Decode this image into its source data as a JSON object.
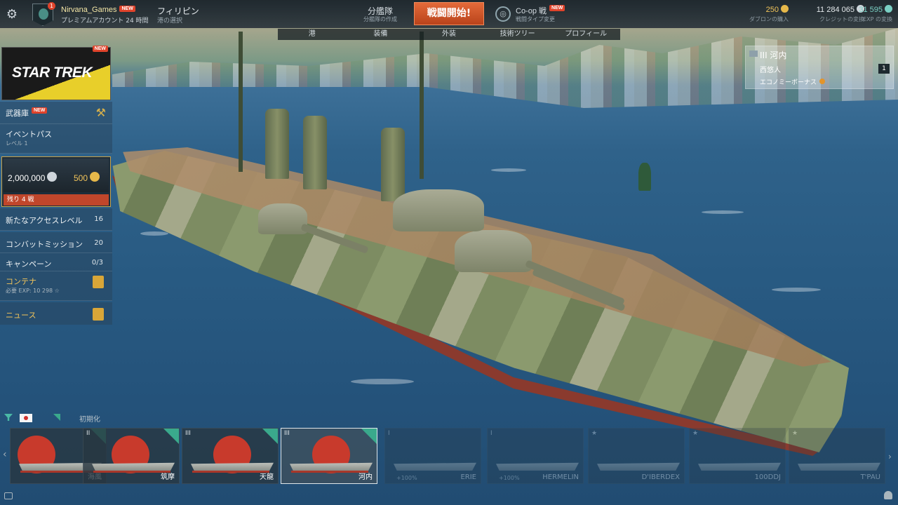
{
  "topbar": {
    "settings_icon": "gear-icon",
    "player": {
      "name": "Nirvana_Games",
      "new_badge": "NEW",
      "premium": "プレミアムアカウント 24 時間",
      "emblem_badge": "1"
    },
    "region": {
      "name": "フィリピン",
      "sub": "港の選択"
    },
    "division": {
      "label": "分艦隊",
      "sub": "分艦隊の作成"
    },
    "battle_button": "戦闘開始!",
    "mode": {
      "label": "Co-op 戦",
      "new_badge": "NEW",
      "sub": "戦闘タイプ変更"
    },
    "currencies": [
      {
        "value": "250",
        "sub": "ダブロンの購入",
        "color": "#e6b84a"
      },
      {
        "value": "11 284 065",
        "sub": "クレジットの変換",
        "color": "#cfd6dc"
      },
      {
        "value": "31 595",
        "sub": "EXP の変換",
        "color": "#7ad0c4"
      }
    ]
  },
  "subnav": {
    "tabs": [
      "港",
      "装備",
      "外装",
      "技術ツリー",
      "プロフィール"
    ]
  },
  "left_panel": {
    "star_trek": {
      "logo": "STAR TREK",
      "new_badge": "NEW"
    },
    "armory": {
      "label": "武器庫",
      "new_badge": "NEW"
    },
    "event_pass": {
      "label": "イベントパス",
      "level": "レベル 1"
    },
    "wallet": {
      "credits": "2,000,000",
      "gold": "500",
      "remaining": "残り 4 戦"
    },
    "access_level": {
      "label": "新たなアクセスレベル",
      "value": "16"
    },
    "combat_missions": {
      "label": "コンバットミッション",
      "value": "20"
    },
    "campaign": {
      "label": "キャンペーン",
      "value": "0/3"
    },
    "containers": {
      "label": "コンテナ",
      "sub": "必要 EXP: 10 298 ☆"
    },
    "news": {
      "label": "ニュース"
    }
  },
  "ship_panel": {
    "tier_name": "III 河内",
    "commander": "西悠人",
    "commander_count": "1",
    "economy": "エコノミーボーナス"
  },
  "carousel": {
    "reset": "初期化",
    "cards": [
      {
        "tier": "",
        "name": "海風",
        "bonus": "",
        "selected": false,
        "dim": false
      },
      {
        "tier": "II",
        "name": "筑摩",
        "bonus": "",
        "selected": false,
        "dim": false
      },
      {
        "tier": "III",
        "name": "天龍",
        "bonus": "",
        "selected": false,
        "dim": false
      },
      {
        "tier": "III",
        "name": "河内",
        "bonus": "",
        "selected": true,
        "dim": false
      },
      {
        "tier": "I",
        "name": "ERIE",
        "bonus": "+100%",
        "selected": false,
        "dim": true
      },
      {
        "tier": "I",
        "name": "HERMELIN",
        "bonus": "+100%",
        "selected": false,
        "dim": true
      },
      {
        "tier": "★",
        "name": "D'IBERDEX",
        "bonus": "",
        "selected": false,
        "dim": true
      },
      {
        "tier": "★",
        "name": "100DDJ",
        "bonus": "",
        "selected": false,
        "dim": true
      },
      {
        "tier": "★",
        "name": "T'PAU",
        "bonus": "",
        "selected": false,
        "dim": true
      }
    ]
  }
}
